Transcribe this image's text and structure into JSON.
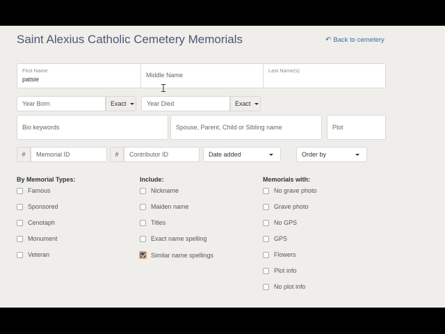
{
  "header": {
    "title": "Saint Alexius Catholic Cemetery Memorials",
    "back_link": "Back to cemetery"
  },
  "name_fields": {
    "first_label": "First Name",
    "first_value": "patsie",
    "middle_placeholder": "Middle Name",
    "last_label": "Last Name(s)"
  },
  "dates": {
    "year_born_placeholder": "Year Born",
    "born_match": "Exact",
    "year_died_placeholder": "Year Died",
    "died_match": "Exact"
  },
  "keywords": {
    "bio_placeholder": "Bio keywords",
    "relatives_placeholder": "Spouse, Parent, Child or Sibling name",
    "plot_placeholder": "Plot"
  },
  "ids": {
    "hash": "#",
    "memorial_id_placeholder": "Memorial ID",
    "contributor_id_placeholder": "Contributor ID",
    "date_added": "Date added",
    "order_by": "Order by"
  },
  "memorial_types": {
    "heading": "By Memorial Types:",
    "items": [
      "Famous",
      "Sponsored",
      "Cenotaph",
      "Monument",
      "Veteran"
    ]
  },
  "include": {
    "heading": "Include:",
    "items": [
      "Nickname",
      "Maiden name",
      "Titles",
      "Exact name spelling",
      "Similar name spellings"
    ],
    "checked": [
      false,
      false,
      false,
      false,
      true
    ]
  },
  "memorials_with": {
    "heading": "Memorials with:",
    "items": [
      "No grave photo",
      "Grave photo",
      "No GPS",
      "GPS",
      "Flowers",
      "Plot info",
      "No plot info"
    ]
  },
  "colors": {
    "title": "#4d5677",
    "link": "#3c6a9c",
    "checkbox_checked_fill": "#4a4f7a",
    "checkbox_focus_ring": "#d9a45a"
  }
}
